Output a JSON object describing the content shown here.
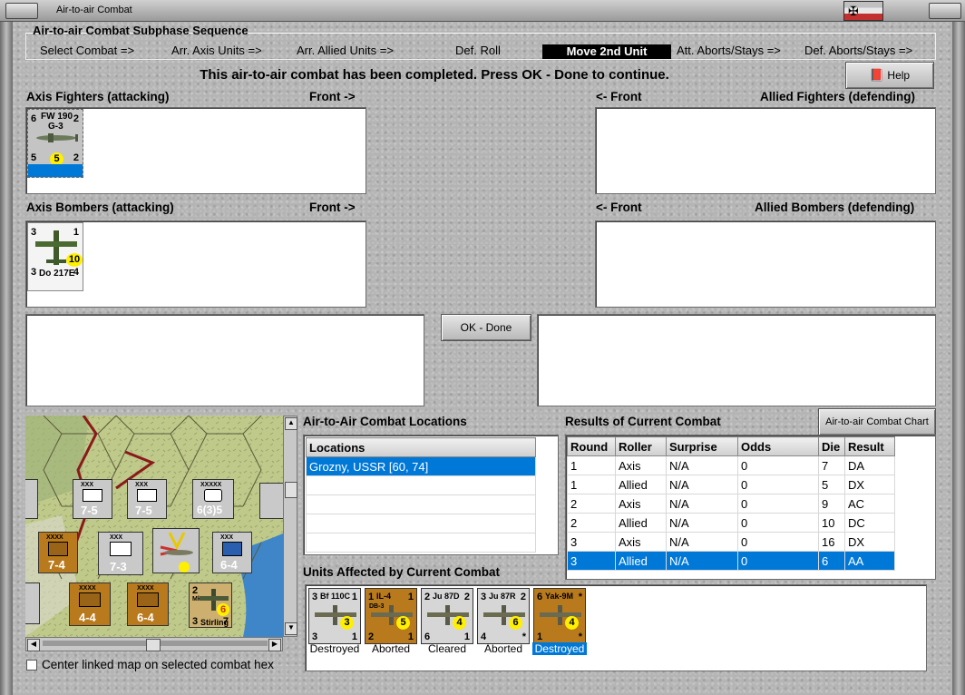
{
  "window": {
    "title": "Air-to-air Combat"
  },
  "sequence": {
    "label": "Air-to-air Combat Subphase Sequence",
    "items": [
      "Select Combat =>",
      "Arr. Axis Units =>",
      "Arr. Allied Units =>",
      "Def. Roll",
      "Move 2nd Unit",
      "Att. Aborts/Stays =>",
      "Def. Aborts/Stays =>"
    ],
    "active_index": 4
  },
  "message": "This air-to-air combat has been completed.  Press OK - Done to continue.",
  "help_button": "Help",
  "axis_fighters": {
    "header": "Axis Fighters (attacking)",
    "front": "Front ->",
    "counter": {
      "name": "FW 190",
      "variant": "G-3",
      "tl": "6",
      "tr": "2",
      "bl": "5",
      "br": "2",
      "circle": "5"
    }
  },
  "allied_fighters": {
    "front": "<- Front",
    "header": "Allied Fighters (defending)"
  },
  "axis_bombers": {
    "header": "Axis Bombers (attacking)",
    "front": "Front ->",
    "counter": {
      "name": "Do 217E",
      "tl": "3",
      "tr": "1",
      "bl": "3",
      "br": "4",
      "circle": "10"
    }
  },
  "allied_bombers": {
    "front": "<- Front",
    "header": "Allied Bombers (defending)"
  },
  "ok_button": "OK - Done",
  "locations": {
    "title": "Air-to-Air Combat Locations",
    "column": "Locations",
    "rows": [
      "Grozny, USSR [60, 74]"
    ]
  },
  "results": {
    "title": "Results of Current Combat",
    "chart_button": "Air-to-air Combat Chart",
    "columns": [
      "Round",
      "Roller",
      "Surprise",
      "Odds",
      "Die",
      "Result"
    ],
    "rows": [
      [
        "1",
        "Axis",
        "N/A",
        "0",
        "7",
        "DA"
      ],
      [
        "1",
        "Allied",
        "N/A",
        "0",
        "5",
        "DX"
      ],
      [
        "2",
        "Axis",
        "N/A",
        "0",
        "9",
        "AC"
      ],
      [
        "2",
        "Allied",
        "N/A",
        "0",
        "10",
        "DC"
      ],
      [
        "3",
        "Axis",
        "N/A",
        "0",
        "16",
        "DX"
      ],
      [
        "3",
        "Allied",
        "N/A",
        "0",
        "6",
        "AA"
      ]
    ],
    "selected_row": 5
  },
  "affected": {
    "title": "Units Affected by Current Combat",
    "units": [
      {
        "name": "Bf 110C",
        "tl": "3",
        "tr": "1",
        "bl": "3",
        "br": "1",
        "circle": "3",
        "status": "Destroyed",
        "color": "#d6d6d6",
        "selected": false
      },
      {
        "name": "IL-4",
        "sub": "DB-3",
        "tl": "1",
        "tr": "1",
        "bl": "2",
        "br": "1",
        "circle": "5",
        "status": "Aborted",
        "color": "#b87a1c",
        "selected": false
      },
      {
        "name": "Ju 87D",
        "tl": "2",
        "tr": "2",
        "bl": "6",
        "br": "1",
        "circle": "4",
        "status": "Cleared",
        "color": "#d6d6d6",
        "selected": false
      },
      {
        "name": "Ju 87R",
        "tl": "3",
        "tr": "2",
        "bl": "4",
        "br": "*",
        "circle": "6",
        "status": "Aborted",
        "color": "#d6d6d6",
        "selected": false
      },
      {
        "name": "Yak-9M",
        "tl": "6",
        "tr": "*",
        "bl": "1",
        "br": "*",
        "circle": "4",
        "status": "Destroyed",
        "color": "#b87a1c",
        "selected": true
      }
    ]
  },
  "map": {
    "center_label": "Center linked map on selected combat hex",
    "counters": [
      {
        "label": "7-5",
        "top": "XXX",
        "color": "#c9c9c9"
      },
      {
        "label": "7-5",
        "top": "XXX",
        "color": "#c9c9c9"
      },
      {
        "label": "6(3)5",
        "top": "XXXXX",
        "color": "#c9c9c9"
      },
      {
        "label": "7-4",
        "top": "XXXX",
        "color": "#b87a1c"
      },
      {
        "label": "7-3",
        "top": "XXX",
        "color": "#c9c9c9"
      },
      {
        "label": "6-4",
        "top": "XXX",
        "color": "#c9c9c9"
      },
      {
        "label": "4-4",
        "top": "XXXX",
        "color": "#b87a1c"
      },
      {
        "label": "6-4",
        "top": "XXXX",
        "color": "#b87a1c"
      }
    ],
    "stirling": {
      "name": "Stirling",
      "tl": "2",
      "bl": "3",
      "br": "7",
      "circle": "6",
      "sub": "Mk. I"
    }
  }
}
